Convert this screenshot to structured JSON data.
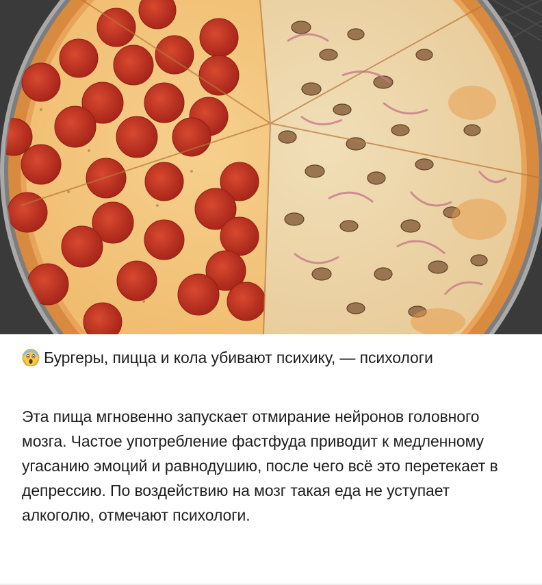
{
  "post": {
    "image": {
      "alt_icon": "pizza-photo",
      "colors": {
        "crust": "#d98a3b",
        "cheese": "#f0c87a",
        "pepperoni": "#c0321f",
        "mushroom": "#8a6a45",
        "pan": "#9a9a9a",
        "background": "#2b2b2b"
      }
    },
    "emoji_icon": "screaming-face-icon",
    "headline": "Бургеры, пицца и кола убивают психику, — психологи",
    "body": "Эта пища мгновенно запускает отмирание нейронов головного мозга. Частое употребление фастфуда приводит к медленному угасанию эмоций и равнодушию, после чего всё это перетекает в депрессию. По воздействию на мозг такая еда не уступает алкоголю, отмечают психологи."
  }
}
